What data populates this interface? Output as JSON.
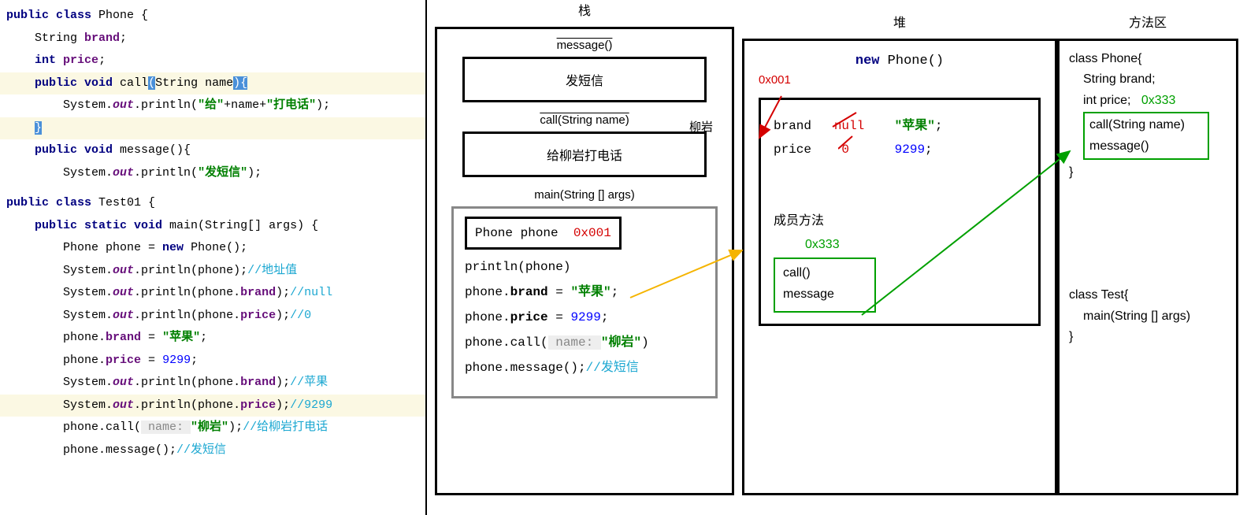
{
  "code": {
    "l1": "public class Phone {",
    "l2": "    String brand;",
    "l3": "    int price;",
    "l4": "    public void call(String name){",
    "l5a": "        System.",
    "l5b": "out",
    "l5c": ".println(",
    "l5d": "\"给\"",
    "l5e": "+name+",
    "l5f": "\"打电话\"",
    "l5g": ");",
    "l6": "    }",
    "l7": "    public void message(){",
    "l8a": "        System.",
    "l8b": "out",
    "l8c": ".println(",
    "l8d": "\"发短信\"",
    "l8e": ");",
    "l9": "public class Test01 {",
    "l10": "    public static void main(String[] args) {",
    "l11a": "        Phone phone = ",
    "l11b": "new",
    "l11c": " Phone();",
    "l12a": "        System.",
    "l12b": "out",
    "l12c": ".println(phone);",
    "l12d": "//地址值",
    "l13a": "        System.",
    "l13c": ".println(phone.",
    "l13d": "brand",
    "l13e": ");",
    "l13f": "//null",
    "l14d": "price",
    "l14f": "//0",
    "l15a": "        phone.",
    "l15b": "brand",
    "l15c": " = ",
    "l15d": "\"苹果\"",
    "l15e": ";",
    "l16b": "price",
    "l16d": "9299",
    "l17f": "//苹果",
    "l18f": "//9299",
    "l19a": "        phone.call(",
    "l19b": " name: ",
    "l19c": "\"柳岩\"",
    "l19d": ");",
    "l19e": "//给柳岩打电话",
    "l20a": "        phone.message();",
    "l20b": "//发短信"
  },
  "stack": {
    "title": "栈",
    "f1_label": "message()",
    "f1_box": "发短信",
    "f2_label": "call(String name)",
    "f2_side": "柳岩",
    "f2_box": "给柳岩打电话",
    "main_label": "main(String [] args)",
    "phone_var": "Phone phone",
    "phone_addr": "0x001",
    "m1": "println(phone)",
    "m2a": "phone.",
    "m2b": "brand",
    "m2c": " = ",
    "m2d": "\"苹果\"",
    "m2e": ";",
    "m3b": "price",
    "m3d": "9299",
    "m4a": " phone.call(",
    "m4b": " name: ",
    "m4c": "\"柳岩\"",
    "m4d": ")",
    "m5a": "  phone.message();",
    "m5b": "//发短信"
  },
  "heap": {
    "title": "堆",
    "new_phone": "new Phone()",
    "addr1": "0x001",
    "brand_k": "brand",
    "brand_old": "null",
    "brand_new": "\"苹果\"",
    "price_k": "price",
    "price_old": "0",
    "price_new": "9299",
    "sc_label": "成员方法",
    "addr2": "0x333",
    "m1": "call()",
    "m2": "message"
  },
  "method_area": {
    "title": "方法区",
    "cls_phone": "class Phone{",
    "fld1": "String brand;",
    "fld2": "int price;",
    "addr": "0x333",
    "m1": "call(String name)",
    "m2": "message()",
    "close": "}",
    "cls_test": "class Test{",
    "main": "main(String [] args)"
  }
}
